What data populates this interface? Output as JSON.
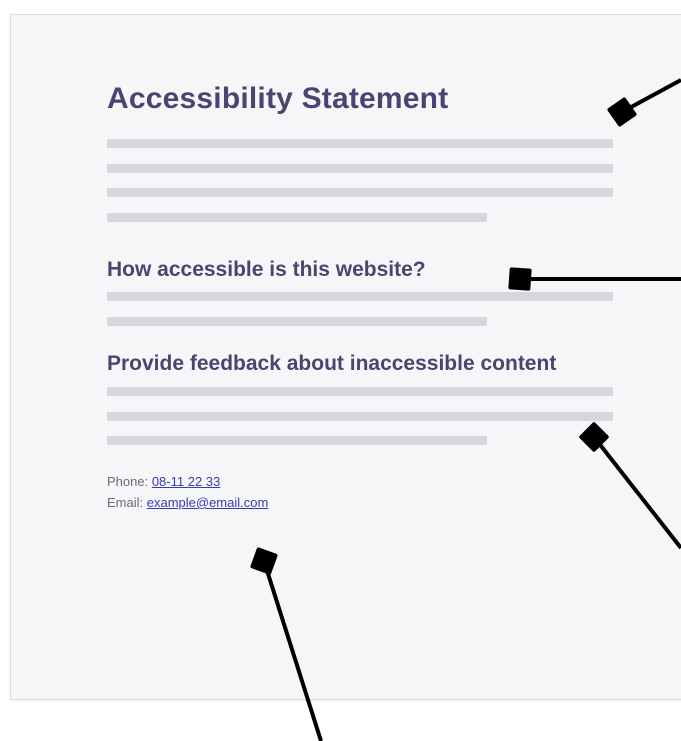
{
  "colors": {
    "heading": "#4a4570",
    "placeholder_line": "#d7d6dd",
    "link": "#3b3bb0",
    "callout": "#000000"
  },
  "statement": {
    "title": "Accessibility Statement",
    "section_1_heading": "How accessible is this website?",
    "section_2_heading": "Provide feedback about inaccessible content",
    "phone_label": "Phone: ",
    "phone_value": "08-11 22 33",
    "email_label": "Email: ",
    "email_value": "example@email.com"
  }
}
